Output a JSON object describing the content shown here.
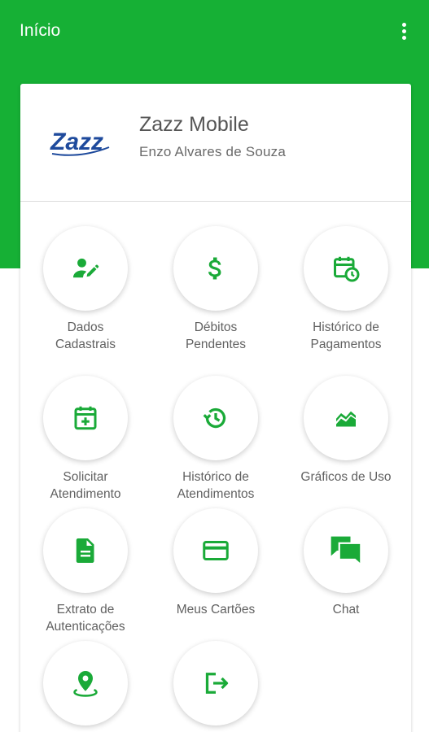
{
  "app_bar": {
    "title": "Início",
    "overflow_icon": "more-vert-icon"
  },
  "colors": {
    "primary": "#16b035",
    "icon": "#1aaa38",
    "text": "#616161",
    "logo": "#1e4a9c"
  },
  "profile": {
    "logo_icon": "zazz-logo",
    "logo_text": "Zazz",
    "company": "Zazz Mobile",
    "user_name": "Enzo Alvares de Souza"
  },
  "menu": [
    {
      "label": "Dados\nCadastrais",
      "icon": "user-edit-icon"
    },
    {
      "label": "Débitos\nPendentes",
      "icon": "dollar-icon"
    },
    {
      "label": "Histórico de\nPagamentos",
      "icon": "calendar-clock-icon"
    },
    {
      "label": "Solicitar\nAtendimento",
      "icon": "calendar-plus-icon"
    },
    {
      "label": "Histórico de\nAtendimentos",
      "icon": "history-icon"
    },
    {
      "label": "Gráficos de Uso",
      "icon": "area-chart-icon"
    },
    {
      "label": "Extrato de\nAutenticações",
      "icon": "document-icon"
    },
    {
      "label": "Meus Cartões",
      "icon": "credit-card-icon"
    },
    {
      "label": "Chat",
      "icon": "chat-icon"
    },
    {
      "label": "",
      "icon": "location-pin-icon"
    },
    {
      "label": "",
      "icon": "logout-icon"
    }
  ]
}
